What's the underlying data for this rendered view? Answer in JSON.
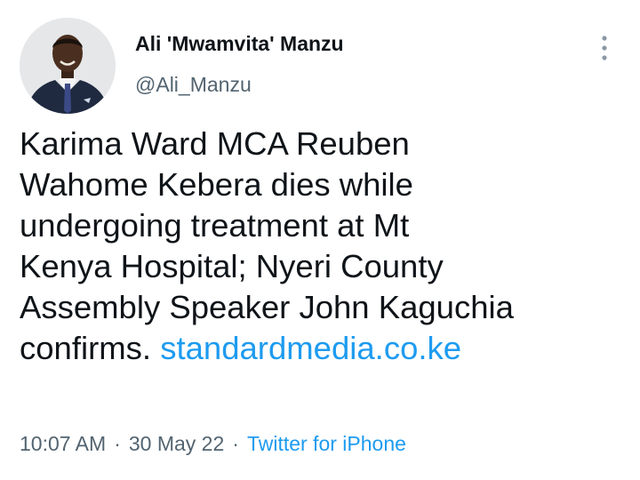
{
  "author": {
    "display_name": "Ali 'Mwamvita' Manzu",
    "handle": "@Ali_Manzu",
    "avatar": "profile-photo"
  },
  "tweet": {
    "text_lines": [
      "Karima Ward MCA Reuben",
      "Wahome Kebera dies while",
      "undergoing treatment at Mt",
      "Kenya Hospital; Nyeri County",
      "Assembly Speaker John Kaguchia",
      "confirms."
    ],
    "link_text": "standardmedia.co.ke"
  },
  "meta": {
    "time": "10:07 AM",
    "separator": "·",
    "date": "30 May 22",
    "source": "Twitter for iPhone"
  },
  "icons": {
    "more": "more-vertical-icon"
  },
  "colors": {
    "text": "#0f1419",
    "secondary": "#536471",
    "link": "#1d9bf0",
    "background": "#ffffff"
  }
}
